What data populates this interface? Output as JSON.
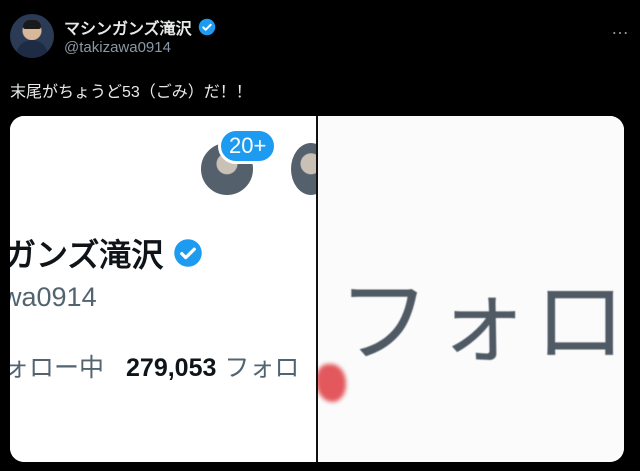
{
  "post": {
    "display_name": "マシンガンズ滝沢",
    "handle": "@takizawa0914",
    "more_icon": "…",
    "text": "末尾がちょうど53（ごみ）だ！！"
  },
  "media": {
    "left_panel": {
      "badge": "20+",
      "name": "ガンズ滝沢",
      "handle": "wa0914",
      "following_label": "ォロー中",
      "followers_count": "279,053",
      "followers_label": "フォロ"
    },
    "right_panel": {
      "zoom_text": "フォロ"
    }
  },
  "colors": {
    "background": "#000000",
    "verified": "#1d9bf0",
    "badge": "#1d9bf0",
    "mark": "#e2585d"
  }
}
